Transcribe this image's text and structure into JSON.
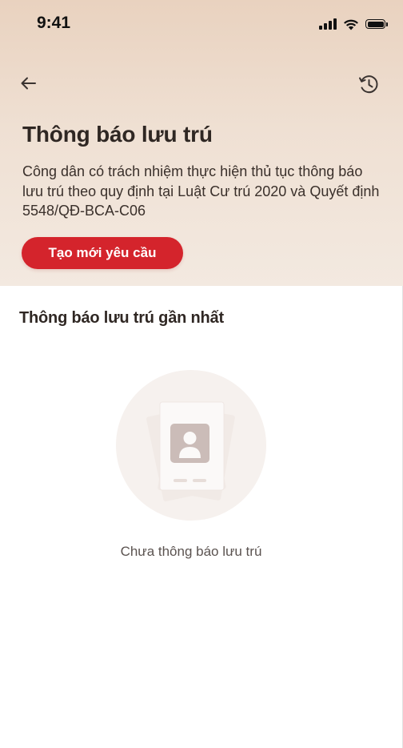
{
  "status_bar": {
    "time": "9:41",
    "icons": [
      "cellular-signal-icon",
      "wifi-icon",
      "battery-icon"
    ]
  },
  "nav": {
    "back_icon": "arrow-left-icon",
    "history_icon": "history-clock-icon"
  },
  "header": {
    "title": "Thông báo lưu trú",
    "description": "Công dân có trách nhiệm thực hiện thủ tục thông báo lưu trú theo quy định tại Luật Cư trú 2020 và Quyết định 5548/QĐ-BCA-C06",
    "create_button_label": "Tạo mới yêu cầu"
  },
  "recent": {
    "section_title": "Thông báo lưu trú gần nhất",
    "empty_icon": "id-document-placeholder-icon",
    "empty_text": "Chưa thông báo lưu trú"
  },
  "colors": {
    "accent": "#d4242c",
    "header_gradient_top": "#e9d2bf",
    "header_gradient_bottom": "#f3e9e0",
    "title_text": "#2f2723"
  }
}
